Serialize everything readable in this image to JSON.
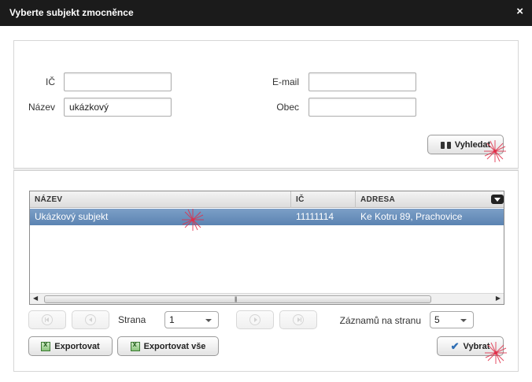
{
  "dialog": {
    "title": "Vyberte subjekt zmocněnce",
    "close_glyph": "×"
  },
  "search": {
    "ic_label": "IČ",
    "ic_value": "",
    "name_label": "Název",
    "name_value": "ukázkový",
    "email_label": "E-mail",
    "email_value": "",
    "city_label": "Obec",
    "city_value": "",
    "search_button": "Vyhledat"
  },
  "grid": {
    "columns": [
      "NÁZEV",
      "IČ",
      "ADRESA"
    ],
    "rows": [
      {
        "name": "Ukázkový subjekt",
        "ic": "11111114",
        "address": "Ke Kotru 89, Prachovice",
        "selected": true
      }
    ],
    "scroll_grip": "|||"
  },
  "pager": {
    "page_label": "Strana",
    "page_value": "1",
    "page_size_label": "Záznamů na stranu",
    "page_size_value": "5"
  },
  "actions": {
    "export_label": "Exportovat",
    "export_all_label": "Exportovat vše",
    "select_label": "Vybrat"
  },
  "icons": {
    "search_button": "binoculars-icon",
    "export": "excel-icon",
    "select": "checkmark-icon",
    "highlight": "cursor-highlight-spark"
  },
  "colors": {
    "titlebar": "#1b1b1b",
    "selected_row": "#5b83b2",
    "spark": "#e0304a"
  }
}
